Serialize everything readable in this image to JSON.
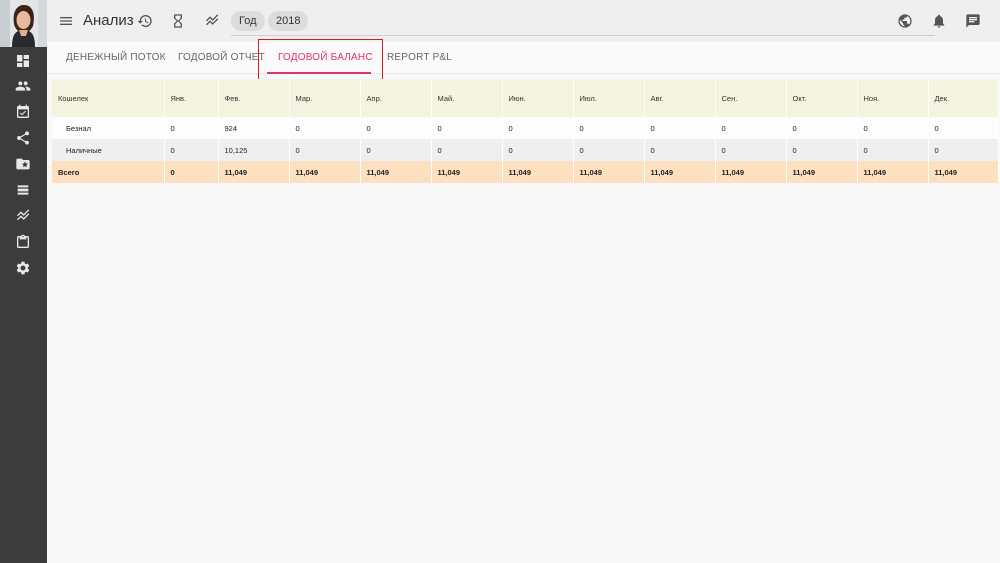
{
  "header": {
    "title": "Анализ",
    "period_chip": "Год",
    "year_chip": "2018"
  },
  "sidebar": {
    "items": [
      {
        "icon": "dashboard-icon"
      },
      {
        "icon": "people-icon"
      },
      {
        "icon": "calendar-check-icon"
      },
      {
        "icon": "share-icon"
      },
      {
        "icon": "folder-star-icon"
      },
      {
        "icon": "list-icon"
      },
      {
        "icon": "trend-icon"
      },
      {
        "icon": "clipboard-icon"
      },
      {
        "icon": "settings-icon"
      }
    ]
  },
  "tabs": [
    {
      "label": "ДЕНЕЖНЫЙ ПОТОК"
    },
    {
      "label": "ГОДОВОЙ ОТЧЕТ"
    },
    {
      "label": "ГОДОВОЙ БАЛАНС"
    },
    {
      "label": "REPORT P&L"
    }
  ],
  "table": {
    "columns": [
      "Кошелек",
      "Янв.",
      "Фев.",
      "Мар.",
      "Апр.",
      "Май.",
      "Июн.",
      "Июл.",
      "Авг.",
      "Сен.",
      "Окт.",
      "Ноя.",
      "Дек."
    ],
    "rows": [
      {
        "name": "Безнал",
        "values": [
          "0",
          "924",
          "0",
          "0",
          "0",
          "0",
          "0",
          "0",
          "0",
          "0",
          "0",
          "0"
        ]
      },
      {
        "name": "Наличные",
        "values": [
          "0",
          "10,125",
          "0",
          "0",
          "0",
          "0",
          "0",
          "0",
          "0",
          "0",
          "0",
          "0"
        ]
      }
    ],
    "total": {
      "name": "Всего",
      "values": [
        "0",
        "11,049",
        "11,049",
        "11,049",
        "11,049",
        "11,049",
        "11,049",
        "11,049",
        "11,049",
        "11,049",
        "11,049",
        "11,049"
      ]
    }
  },
  "colors": {
    "accent": "#e0336e",
    "sidebar": "#3c3c3c",
    "header_row": "#f4f4e0",
    "total_row": "#fde0c0"
  }
}
